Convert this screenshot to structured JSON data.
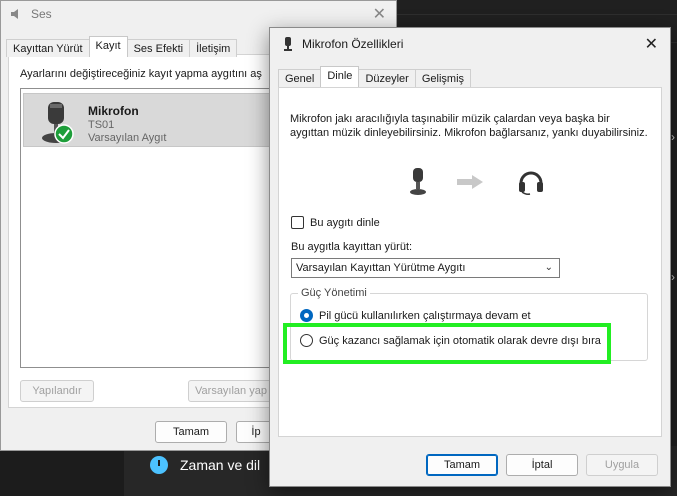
{
  "background": {
    "settings_item": "Zaman ve dil"
  },
  "ses": {
    "title": "Ses",
    "tabs": [
      "Kayıttan Yürüt",
      "Kayıt",
      "Ses Efekti",
      "İletişim"
    ],
    "instruction": "Ayarlarını değiştireceğiniz kayıt yapma aygıtını aş",
    "device": {
      "name": "Mikrofon",
      "model": "TS01",
      "status": "Varsayılan Aygıt"
    },
    "buttons": {
      "configure": "Yapılandır",
      "set_default": "Varsayılan yap",
      "ok": "Tamam",
      "cancel": "İp"
    }
  },
  "mic": {
    "title": "Mikrofon Özellikleri",
    "tabs": [
      "Genel",
      "Dinle",
      "Düzeyler",
      "Gelişmiş"
    ],
    "description": "Mikrofon jakı aracılığıyla taşınabilir müzik çalardan veya başka bir aygıttan müzik dinleyebilirsiniz. Mikrofon bağlarsanız, yankı duyabilirsiniz.",
    "listen_checkbox": "Bu aygıtı dinle",
    "playback_label": "Bu aygıtla kayıttan yürüt:",
    "playback_select": "Varsayılan Kayıttan Yürütme Aygıtı",
    "power": {
      "legend": "Güç Yönetimi",
      "option_continue": "Pil gücü kullanılırken çalıştırmaya devam et",
      "option_disable": "Güç kazancı sağlamak için otomatik olarak devre dışı bıra"
    },
    "buttons": {
      "ok": "Tamam",
      "cancel": "İptal",
      "apply": "Uygula"
    }
  },
  "colors": {
    "accent": "#0067c0",
    "highlight": "#22ee22",
    "check_badge": "#1e9e3a"
  }
}
